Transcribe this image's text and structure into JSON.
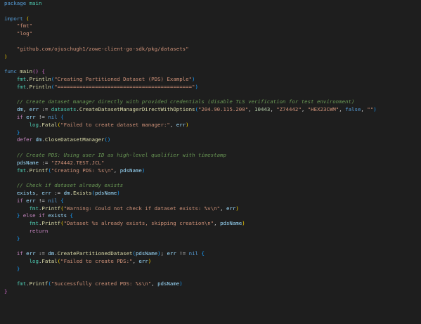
{
  "editor": {
    "lines": [
      [
        {
          "c": "kw",
          "t": "package"
        },
        {
          "c": "txt",
          "t": " "
        },
        {
          "c": "pkg",
          "t": "main"
        }
      ],
      [],
      [
        {
          "c": "kw",
          "t": "import"
        },
        {
          "c": "txt",
          "t": " "
        },
        {
          "c": "br1",
          "t": "("
        }
      ],
      [
        {
          "c": "txt",
          "t": "    "
        },
        {
          "c": "str",
          "t": "\"fmt\""
        }
      ],
      [
        {
          "c": "txt",
          "t": "    "
        },
        {
          "c": "str",
          "t": "\"log\""
        }
      ],
      [],
      [
        {
          "c": "txt",
          "t": "    "
        },
        {
          "c": "str",
          "t": "\"github.com/ojuschugh1/zowe-client-go-sdk/pkg/datasets\""
        }
      ],
      [
        {
          "c": "br1",
          "t": ")"
        }
      ],
      [],
      [
        {
          "c": "kw",
          "t": "func"
        },
        {
          "c": "txt",
          "t": " "
        },
        {
          "c": "fn",
          "t": "main"
        },
        {
          "c": "br2",
          "t": "()"
        },
        {
          "c": "txt",
          "t": " "
        },
        {
          "c": "br2",
          "t": "{"
        }
      ],
      [
        {
          "c": "txt",
          "t": "    "
        },
        {
          "c": "pkg",
          "t": "fmt"
        },
        {
          "c": "txt",
          "t": "."
        },
        {
          "c": "fn",
          "t": "Println"
        },
        {
          "c": "br3",
          "t": "("
        },
        {
          "c": "str",
          "t": "\"Creating Partitioned Dataset (PDS) Example\""
        },
        {
          "c": "br3",
          "t": ")"
        }
      ],
      [
        {
          "c": "txt",
          "t": "    "
        },
        {
          "c": "pkg",
          "t": "fmt"
        },
        {
          "c": "txt",
          "t": "."
        },
        {
          "c": "fn",
          "t": "Println"
        },
        {
          "c": "br3",
          "t": "("
        },
        {
          "c": "str",
          "t": "\"===========================================\""
        },
        {
          "c": "br3",
          "t": ")"
        }
      ],
      [],
      [
        {
          "c": "txt",
          "t": "    "
        },
        {
          "c": "com",
          "t": "// Create dataset manager directly with provided credentials (disable TLS verification for test environment)"
        }
      ],
      [
        {
          "c": "txt",
          "t": "    "
        },
        {
          "c": "var",
          "t": "dm"
        },
        {
          "c": "txt",
          "t": ", "
        },
        {
          "c": "var",
          "t": "err"
        },
        {
          "c": "txt",
          "t": " := "
        },
        {
          "c": "pkg",
          "t": "datasets"
        },
        {
          "c": "txt",
          "t": "."
        },
        {
          "c": "fn",
          "t": "CreateDatasetManagerDirectWithOptions"
        },
        {
          "c": "br3",
          "t": "("
        },
        {
          "c": "str",
          "t": "\"204.90.115.200\""
        },
        {
          "c": "txt",
          "t": ", "
        },
        {
          "c": "num",
          "t": "10443"
        },
        {
          "c": "txt",
          "t": ", "
        },
        {
          "c": "str",
          "t": "\"Z74442\""
        },
        {
          "c": "txt",
          "t": ", "
        },
        {
          "c": "str",
          "t": "\"HEX23CWM\""
        },
        {
          "c": "txt",
          "t": ", "
        },
        {
          "c": "kw",
          "t": "false"
        },
        {
          "c": "txt",
          "t": ", "
        },
        {
          "c": "str",
          "t": "\"\""
        },
        {
          "c": "br3",
          "t": ")"
        }
      ],
      [
        {
          "c": "txt",
          "t": "    "
        },
        {
          "c": "ctl",
          "t": "if"
        },
        {
          "c": "txt",
          "t": " "
        },
        {
          "c": "var",
          "t": "err"
        },
        {
          "c": "txt",
          "t": " != "
        },
        {
          "c": "kw",
          "t": "nil"
        },
        {
          "c": "txt",
          "t": " "
        },
        {
          "c": "br3",
          "t": "{"
        }
      ],
      [
        {
          "c": "txt",
          "t": "        "
        },
        {
          "c": "pkg",
          "t": "log"
        },
        {
          "c": "txt",
          "t": "."
        },
        {
          "c": "fn",
          "t": "Fatal"
        },
        {
          "c": "br1",
          "t": "("
        },
        {
          "c": "str",
          "t": "\"Failed to create dataset manager:\""
        },
        {
          "c": "txt",
          "t": ", "
        },
        {
          "c": "var",
          "t": "err"
        },
        {
          "c": "br1",
          "t": ")"
        }
      ],
      [
        {
          "c": "txt",
          "t": "    "
        },
        {
          "c": "br3",
          "t": "}"
        }
      ],
      [
        {
          "c": "txt",
          "t": "    "
        },
        {
          "c": "ctl",
          "t": "defer"
        },
        {
          "c": "txt",
          "t": " "
        },
        {
          "c": "var",
          "t": "dm"
        },
        {
          "c": "txt",
          "t": "."
        },
        {
          "c": "fn",
          "t": "CloseDatasetManager"
        },
        {
          "c": "br3",
          "t": "()"
        }
      ],
      [],
      [
        {
          "c": "txt",
          "t": "    "
        },
        {
          "c": "com",
          "t": "// Create PDS: Using user ID as high-level qualifier with timestamp"
        }
      ],
      [
        {
          "c": "txt",
          "t": "    "
        },
        {
          "c": "var",
          "t": "pdsName"
        },
        {
          "c": "txt",
          "t": " := "
        },
        {
          "c": "str",
          "t": "\"Z74442.TEST.JCL\""
        }
      ],
      [
        {
          "c": "txt",
          "t": "    "
        },
        {
          "c": "pkg",
          "t": "fmt"
        },
        {
          "c": "txt",
          "t": "."
        },
        {
          "c": "fn",
          "t": "Printf"
        },
        {
          "c": "br3",
          "t": "("
        },
        {
          "c": "str",
          "t": "\"Creating PDS: %s\\n\""
        },
        {
          "c": "txt",
          "t": ", "
        },
        {
          "c": "var",
          "t": "pdsName"
        },
        {
          "c": "br3",
          "t": ")"
        }
      ],
      [],
      [
        {
          "c": "txt",
          "t": "    "
        },
        {
          "c": "com",
          "t": "// Check if dataset already exists"
        }
      ],
      [
        {
          "c": "txt",
          "t": "    "
        },
        {
          "c": "var",
          "t": "exists"
        },
        {
          "c": "txt",
          "t": ", "
        },
        {
          "c": "var",
          "t": "err"
        },
        {
          "c": "txt",
          "t": " := "
        },
        {
          "c": "var",
          "t": "dm"
        },
        {
          "c": "txt",
          "t": "."
        },
        {
          "c": "fn",
          "t": "Exists"
        },
        {
          "c": "br3",
          "t": "("
        },
        {
          "c": "var",
          "t": "pdsName"
        },
        {
          "c": "br3",
          "t": ")"
        }
      ],
      [
        {
          "c": "txt",
          "t": "    "
        },
        {
          "c": "ctl",
          "t": "if"
        },
        {
          "c": "txt",
          "t": " "
        },
        {
          "c": "var",
          "t": "err"
        },
        {
          "c": "txt",
          "t": " != "
        },
        {
          "c": "kw",
          "t": "nil"
        },
        {
          "c": "txt",
          "t": " "
        },
        {
          "c": "br3",
          "t": "{"
        }
      ],
      [
        {
          "c": "txt",
          "t": "        "
        },
        {
          "c": "pkg",
          "t": "fmt"
        },
        {
          "c": "txt",
          "t": "."
        },
        {
          "c": "fn",
          "t": "Printf"
        },
        {
          "c": "br1",
          "t": "("
        },
        {
          "c": "str",
          "t": "\"Warning: Could not check if dataset exists: %v\\n\""
        },
        {
          "c": "txt",
          "t": ", "
        },
        {
          "c": "var",
          "t": "err"
        },
        {
          "c": "br1",
          "t": ")"
        }
      ],
      [
        {
          "c": "txt",
          "t": "    "
        },
        {
          "c": "br3",
          "t": "}"
        },
        {
          "c": "txt",
          "t": " "
        },
        {
          "c": "ctl",
          "t": "else"
        },
        {
          "c": "txt",
          "t": " "
        },
        {
          "c": "ctl",
          "t": "if"
        },
        {
          "c": "txt",
          "t": " "
        },
        {
          "c": "var",
          "t": "exists"
        },
        {
          "c": "txt",
          "t": " "
        },
        {
          "c": "br3",
          "t": "{"
        }
      ],
      [
        {
          "c": "txt",
          "t": "        "
        },
        {
          "c": "pkg",
          "t": "fmt"
        },
        {
          "c": "txt",
          "t": "."
        },
        {
          "c": "fn",
          "t": "Printf"
        },
        {
          "c": "br1",
          "t": "("
        },
        {
          "c": "str",
          "t": "\"Dataset %s already exists, skipping creation\\n\""
        },
        {
          "c": "txt",
          "t": ", "
        },
        {
          "c": "var",
          "t": "pdsName"
        },
        {
          "c": "br1",
          "t": ")"
        }
      ],
      [
        {
          "c": "txt",
          "t": "        "
        },
        {
          "c": "ctl",
          "t": "return"
        }
      ],
      [
        {
          "c": "txt",
          "t": "    "
        },
        {
          "c": "br3",
          "t": "}"
        }
      ],
      [],
      [
        {
          "c": "txt",
          "t": "    "
        },
        {
          "c": "ctl",
          "t": "if"
        },
        {
          "c": "txt",
          "t": " "
        },
        {
          "c": "var",
          "t": "err"
        },
        {
          "c": "txt",
          "t": " := "
        },
        {
          "c": "var",
          "t": "dm"
        },
        {
          "c": "txt",
          "t": "."
        },
        {
          "c": "fn",
          "t": "CreatePartitionedDataset"
        },
        {
          "c": "br3",
          "t": "("
        },
        {
          "c": "var",
          "t": "pdsName"
        },
        {
          "c": "br3",
          "t": ")"
        },
        {
          "c": "txt",
          "t": "; "
        },
        {
          "c": "var",
          "t": "err"
        },
        {
          "c": "txt",
          "t": " != "
        },
        {
          "c": "kw",
          "t": "nil"
        },
        {
          "c": "txt",
          "t": " "
        },
        {
          "c": "br3",
          "t": "{"
        }
      ],
      [
        {
          "c": "txt",
          "t": "        "
        },
        {
          "c": "pkg",
          "t": "log"
        },
        {
          "c": "txt",
          "t": "."
        },
        {
          "c": "fn",
          "t": "Fatal"
        },
        {
          "c": "br1",
          "t": "("
        },
        {
          "c": "str",
          "t": "\"Failed to create PDS:\""
        },
        {
          "c": "txt",
          "t": ", "
        },
        {
          "c": "var",
          "t": "err"
        },
        {
          "c": "br1",
          "t": ")"
        }
      ],
      [
        {
          "c": "txt",
          "t": "    "
        },
        {
          "c": "br3",
          "t": "}"
        }
      ],
      [],
      [
        {
          "c": "txt",
          "t": "    "
        },
        {
          "c": "pkg",
          "t": "fmt"
        },
        {
          "c": "txt",
          "t": "."
        },
        {
          "c": "fn",
          "t": "Printf"
        },
        {
          "c": "br3",
          "t": "("
        },
        {
          "c": "str",
          "t": "\"Successfully created PDS: %s\\n\""
        },
        {
          "c": "txt",
          "t": ", "
        },
        {
          "c": "var",
          "t": "pdsName"
        },
        {
          "c": "br3",
          "t": ")"
        }
      ],
      [
        {
          "c": "br2",
          "t": "}"
        }
      ]
    ]
  }
}
